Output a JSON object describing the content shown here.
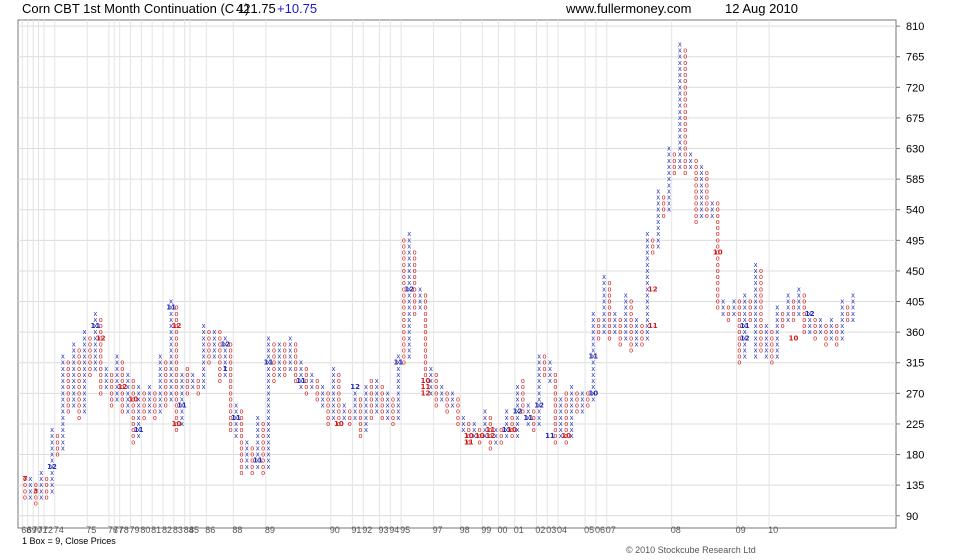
{
  "header": {
    "title": "Corn CBT 1st Month Continuation (C 1)",
    "last_price": "421.75",
    "change": "+10.75",
    "site": "www.fullermoney.com",
    "date": "12 Aug 2010"
  },
  "footer": {
    "box_size": "1 Box = 9, Close Prices",
    "copyright": "© 2010 Stockcube Research Ltd"
  },
  "chart_data": {
    "type": "point-and-figure",
    "box_size": 9,
    "price_basis": "close",
    "ylim": [
      72,
      819
    ],
    "y_ticks": [
      90,
      135,
      180,
      225,
      270,
      315,
      360,
      405,
      450,
      495,
      540,
      585,
      630,
      675,
      720,
      765,
      810
    ],
    "x_year_labels": [
      "68",
      "69",
      "70",
      "71",
      "72",
      "74",
      "75",
      "76",
      "77",
      "78",
      "79",
      "80",
      "81",
      "82",
      "83",
      "84",
      "85",
      "86",
      "88",
      "89",
      "90",
      "91",
      "92",
      "93",
      "94",
      "95",
      "97",
      "98",
      "99",
      "00",
      "01",
      "02",
      "03",
      "04",
      "05",
      "06",
      "07",
      "08",
      "09",
      "10"
    ],
    "columns": [
      {
        "type": "O",
        "high": 144,
        "low": 117
      },
      {
        "type": "X",
        "high": 144,
        "low": 117
      },
      {
        "type": "O",
        "high": 135,
        "low": 108
      },
      {
        "type": "X",
        "high": 153,
        "low": 117
      },
      {
        "type": "O",
        "high": 144,
        "low": 117
      },
      {
        "type": "X",
        "high": 216,
        "low": 126
      },
      {
        "type": "O",
        "high": 207,
        "low": 180
      },
      {
        "type": "X",
        "high": 324,
        "low": 189
      },
      {
        "type": "O",
        "high": 315,
        "low": 243
      },
      {
        "type": "X",
        "high": 342,
        "low": 252
      },
      {
        "type": "O",
        "high": 333,
        "low": 234
      },
      {
        "type": "X",
        "high": 360,
        "low": 243
      },
      {
        "type": "O",
        "high": 351,
        "low": 297
      },
      {
        "type": "X",
        "high": 387,
        "low": 306
      },
      {
        "type": "O",
        "high": 378,
        "low": 270
      },
      {
        "type": "X",
        "high": 306,
        "low": 279
      },
      {
        "type": "O",
        "high": 297,
        "low": 252
      },
      {
        "type": "X",
        "high": 324,
        "low": 261
      },
      {
        "type": "O",
        "high": 315,
        "low": 243
      },
      {
        "type": "X",
        "high": 297,
        "low": 243
      },
      {
        "type": "O",
        "high": 288,
        "low": 198
      },
      {
        "type": "X",
        "high": 279,
        "low": 207
      },
      {
        "type": "O",
        "high": 270,
        "low": 234
      },
      {
        "type": "X",
        "high": 279,
        "low": 243
      },
      {
        "type": "O",
        "high": 270,
        "low": 234
      },
      {
        "type": "X",
        "high": 324,
        "low": 243
      },
      {
        "type": "O",
        "high": 315,
        "low": 252
      },
      {
        "type": "X",
        "high": 405,
        "low": 261
      },
      {
        "type": "O",
        "high": 396,
        "low": 216
      },
      {
        "type": "X",
        "high": 297,
        "low": 225
      },
      {
        "type": "O",
        "high": 306,
        "low": 270
      },
      {
        "type": "X",
        "high": 297,
        "low": 279
      },
      {
        "type": "O",
        "high": 288,
        "low": 270
      },
      {
        "type": "X",
        "high": 369,
        "low": 279
      },
      {
        "type": "O",
        "high": 360,
        "low": 315
      },
      {
        "type": "X",
        "high": 360,
        "low": 324
      },
      {
        "type": "O",
        "high": 360,
        "low": 288
      },
      {
        "type": "X",
        "high": 351,
        "low": 297
      },
      {
        "type": "O",
        "high": 342,
        "low": 216
      },
      {
        "type": "X",
        "high": 252,
        "low": 207
      },
      {
        "type": "O",
        "high": 243,
        "low": 153
      },
      {
        "type": "X",
        "high": 198,
        "low": 162
      },
      {
        "type": "O",
        "high": 189,
        "low": 153
      },
      {
        "type": "X",
        "high": 234,
        "low": 162
      },
      {
        "type": "O",
        "high": 225,
        "low": 153
      },
      {
        "type": "X",
        "high": 351,
        "low": 162
      },
      {
        "type": "O",
        "high": 342,
        "low": 288
      },
      {
        "type": "X",
        "high": 342,
        "low": 297
      },
      {
        "type": "O",
        "high": 342,
        "low": 297
      },
      {
        "type": "X",
        "high": 351,
        "low": 306
      },
      {
        "type": "O",
        "high": 342,
        "low": 288
      },
      {
        "type": "X",
        "high": 315,
        "low": 279
      },
      {
        "type": "O",
        "high": 306,
        "low": 270
      },
      {
        "type": "X",
        "high": 297,
        "low": 279
      },
      {
        "type": "O",
        "high": 288,
        "low": 261
      },
      {
        "type": "X",
        "high": 279,
        "low": 252
      },
      {
        "type": "O",
        "high": 270,
        "low": 225
      },
      {
        "type": "X",
        "high": 306,
        "low": 234
      },
      {
        "type": "O",
        "high": 297,
        "low": 225
      },
      {
        "type": "X",
        "high": 252,
        "low": 234
      },
      {
        "type": "O",
        "high": 243,
        "low": 225
      },
      {
        "type": "X",
        "high": 270,
        "low": 234
      },
      {
        "type": "O",
        "high": 261,
        "low": 207
      },
      {
        "type": "X",
        "high": 279,
        "low": 216
      },
      {
        "type": "O",
        "high": 288,
        "low": 234
      },
      {
        "type": "X",
        "high": 288,
        "low": 243
      },
      {
        "type": "O",
        "high": 279,
        "low": 234
      },
      {
        "type": "X",
        "high": 270,
        "low": 234
      },
      {
        "type": "O",
        "high": 261,
        "low": 225
      },
      {
        "type": "X",
        "high": 324,
        "low": 234
      },
      {
        "type": "O",
        "high": 495,
        "low": 315
      },
      {
        "type": "X",
        "high": 504,
        "low": 324
      },
      {
        "type": "O",
        "high": 477,
        "low": 387
      },
      {
        "type": "X",
        "high": 423,
        "low": 396
      },
      {
        "type": "O",
        "high": 414,
        "low": 297
      },
      {
        "type": "X",
        "high": 306,
        "low": 270
      },
      {
        "type": "O",
        "high": 297,
        "low": 252
      },
      {
        "type": "X",
        "high": 279,
        "low": 261
      },
      {
        "type": "O",
        "high": 270,
        "low": 243
      },
      {
        "type": "X",
        "high": 270,
        "low": 252
      },
      {
        "type": "O",
        "high": 261,
        "low": 225
      },
      {
        "type": "X",
        "high": 234,
        "low": 216
      },
      {
        "type": "O",
        "high": 225,
        "low": 198
      },
      {
        "type": "X",
        "high": 225,
        "low": 207
      },
      {
        "type": "O",
        "high": 216,
        "low": 198
      },
      {
        "type": "X",
        "high": 243,
        "low": 207
      },
      {
        "type": "O",
        "high": 234,
        "low": 189
      },
      {
        "type": "X",
        "high": 216,
        "low": 198
      },
      {
        "type": "O",
        "high": 216,
        "low": 198
      },
      {
        "type": "X",
        "high": 243,
        "low": 207
      },
      {
        "type": "O",
        "high": 234,
        "low": 207
      },
      {
        "type": "X",
        "high": 279,
        "low": 207
      },
      {
        "type": "O",
        "high": 288,
        "low": 243
      },
      {
        "type": "X",
        "high": 252,
        "low": 225
      },
      {
        "type": "O",
        "high": 243,
        "low": 216
      },
      {
        "type": "X",
        "high": 324,
        "low": 225
      },
      {
        "type": "O",
        "high": 324,
        "low": 297
      },
      {
        "type": "X",
        "high": 315,
        "low": 288
      },
      {
        "type": "O",
        "high": 297,
        "low": 198
      },
      {
        "type": "X",
        "high": 261,
        "low": 207
      },
      {
        "type": "O",
        "high": 270,
        "low": 198
      },
      {
        "type": "X",
        "high": 279,
        "low": 207
      },
      {
        "type": "O",
        "high": 270,
        "low": 243
      },
      {
        "type": "X",
        "high": 270,
        "low": 243
      },
      {
        "type": "O",
        "high": 270,
        "low": 252
      },
      {
        "type": "X",
        "high": 387,
        "low": 261
      },
      {
        "type": "O",
        "high": 378,
        "low": 351
      },
      {
        "type": "X",
        "high": 441,
        "low": 360
      },
      {
        "type": "O",
        "high": 432,
        "low": 351
      },
      {
        "type": "X",
        "high": 387,
        "low": 360
      },
      {
        "type": "O",
        "high": 378,
        "low": 342
      },
      {
        "type": "X",
        "high": 414,
        "low": 351
      },
      {
        "type": "O",
        "high": 405,
        "low": 333
      },
      {
        "type": "X",
        "high": 378,
        "low": 342
      },
      {
        "type": "O",
        "high": 369,
        "low": 342
      },
      {
        "type": "X",
        "high": 504,
        "low": 351
      },
      {
        "type": "O",
        "high": 495,
        "low": 477
      },
      {
        "type": "X",
        "high": 567,
        "low": 486
      },
      {
        "type": "O",
        "high": 558,
        "low": 531
      },
      {
        "type": "X",
        "high": 630,
        "low": 540
      },
      {
        "type": "O",
        "high": 621,
        "low": 594
      },
      {
        "type": "X",
        "high": 783,
        "low": 603
      },
      {
        "type": "O",
        "high": 774,
        "low": 594
      },
      {
        "type": "X",
        "high": 621,
        "low": 603
      },
      {
        "type": "O",
        "high": 612,
        "low": 522
      },
      {
        "type": "X",
        "high": 603,
        "low": 531
      },
      {
        "type": "O",
        "high": 594,
        "low": 531
      },
      {
        "type": "X",
        "high": 549,
        "low": 531
      },
      {
        "type": "O",
        "high": 549,
        "low": 396
      },
      {
        "type": "X",
        "high": 405,
        "low": 387
      },
      {
        "type": "O",
        "high": 396,
        "low": 378
      },
      {
        "type": "X",
        "high": 405,
        "low": 387
      },
      {
        "type": "O",
        "high": 405,
        "low": 315
      },
      {
        "type": "X",
        "high": 414,
        "low": 324
      },
      {
        "type": "O",
        "high": 405,
        "low": 378
      },
      {
        "type": "X",
        "high": 459,
        "low": 324
      },
      {
        "type": "O",
        "high": 450,
        "low": 333
      },
      {
        "type": "X",
        "high": 369,
        "low": 324
      },
      {
        "type": "O",
        "high": 360,
        "low": 315
      },
      {
        "type": "X",
        "high": 396,
        "low": 324
      },
      {
        "type": "O",
        "high": 387,
        "low": 369
      },
      {
        "type": "X",
        "high": 414,
        "low": 378
      },
      {
        "type": "O",
        "high": 405,
        "low": 378
      },
      {
        "type": "X",
        "high": 423,
        "low": 387
      },
      {
        "type": "O",
        "high": 414,
        "low": 360
      },
      {
        "type": "X",
        "high": 387,
        "low": 360
      },
      {
        "type": "O",
        "high": 378,
        "low": 351
      },
      {
        "type": "X",
        "high": 378,
        "low": 360
      },
      {
        "type": "O",
        "high": 369,
        "low": 342
      },
      {
        "type": "X",
        "high": 378,
        "low": 351
      },
      {
        "type": "O",
        "high": 369,
        "low": 342
      },
      {
        "type": "X",
        "high": 405,
        "low": 351
      },
      {
        "type": "O",
        "high": 396,
        "low": 378
      },
      {
        "type": "X",
        "high": 414,
        "low": 378
      }
    ],
    "year_start_column_index": [
      0,
      1,
      2,
      3,
      4,
      6,
      12,
      16,
      17,
      18,
      20,
      22,
      24,
      26,
      28,
      30,
      31,
      34,
      39,
      45,
      57,
      61,
      63,
      66,
      68,
      70,
      76,
      81,
      85,
      88,
      91,
      95,
      97,
      99,
      104,
      106,
      108,
      120,
      132,
      138
    ],
    "month_markers": [
      {
        "col": 0,
        "price": 144,
        "label": "7"
      },
      {
        "col": 2,
        "price": 126,
        "label": "3"
      },
      {
        "col": 5,
        "price": 162,
        "label": "12"
      },
      {
        "col": 13,
        "price": 369,
        "label": "11"
      },
      {
        "col": 14,
        "price": 351,
        "label": "12"
      },
      {
        "col": 18,
        "price": 279,
        "label": "12"
      },
      {
        "col": 20,
        "price": 261,
        "label": "10"
      },
      {
        "col": 21,
        "price": 216,
        "label": "11"
      },
      {
        "col": 27,
        "price": 396,
        "label": "11"
      },
      {
        "col": 28,
        "price": 369,
        "label": "12"
      },
      {
        "col": 28,
        "price": 225,
        "label": "10"
      },
      {
        "col": 29,
        "price": 252,
        "label": "11"
      },
      {
        "col": 37,
        "price": 342,
        "label": "12"
      },
      {
        "col": 37,
        "price": 306,
        "label": "1"
      },
      {
        "col": 39,
        "price": 234,
        "label": "11"
      },
      {
        "col": 43,
        "price": 171,
        "label": "11"
      },
      {
        "col": 45,
        "price": 315,
        "label": "11"
      },
      {
        "col": 51,
        "price": 288,
        "label": "11"
      },
      {
        "col": 58,
        "price": 225,
        "label": "10"
      },
      {
        "col": 61,
        "price": 279,
        "label": "12"
      },
      {
        "col": 69,
        "price": 315,
        "label": "11"
      },
      {
        "col": 71,
        "price": 423,
        "label": "12"
      },
      {
        "col": 74,
        "price": 288,
        "label": "10"
      },
      {
        "col": 74,
        "price": 279,
        "label": "11"
      },
      {
        "col": 74,
        "price": 270,
        "label": "12"
      },
      {
        "col": 82,
        "price": 207,
        "label": "10"
      },
      {
        "col": 82,
        "price": 198,
        "label": "11"
      },
      {
        "col": 84,
        "price": 207,
        "label": "10"
      },
      {
        "col": 86,
        "price": 216,
        "label": "11"
      },
      {
        "col": 86,
        "price": 207,
        "label": "12"
      },
      {
        "col": 89,
        "price": 216,
        "label": "11"
      },
      {
        "col": 90,
        "price": 216,
        "label": "10"
      },
      {
        "col": 91,
        "price": 243,
        "label": "12"
      },
      {
        "col": 93,
        "price": 234,
        "label": "11"
      },
      {
        "col": 95,
        "price": 252,
        "label": "12"
      },
      {
        "col": 97,
        "price": 207,
        "label": "11"
      },
      {
        "col": 100,
        "price": 207,
        "label": "10"
      },
      {
        "col": 105,
        "price": 270,
        "label": "10"
      },
      {
        "col": 105,
        "price": 324,
        "label": "11"
      },
      {
        "col": 116,
        "price": 423,
        "label": "12"
      },
      {
        "col": 116,
        "price": 369,
        "label": "11"
      },
      {
        "col": 128,
        "price": 477,
        "label": "10"
      },
      {
        "col": 133,
        "price": 369,
        "label": "11"
      },
      {
        "col": 133,
        "price": 351,
        "label": "12"
      },
      {
        "col": 142,
        "price": 351,
        "label": "10"
      },
      {
        "col": 145,
        "price": 387,
        "label": "12"
      }
    ]
  }
}
